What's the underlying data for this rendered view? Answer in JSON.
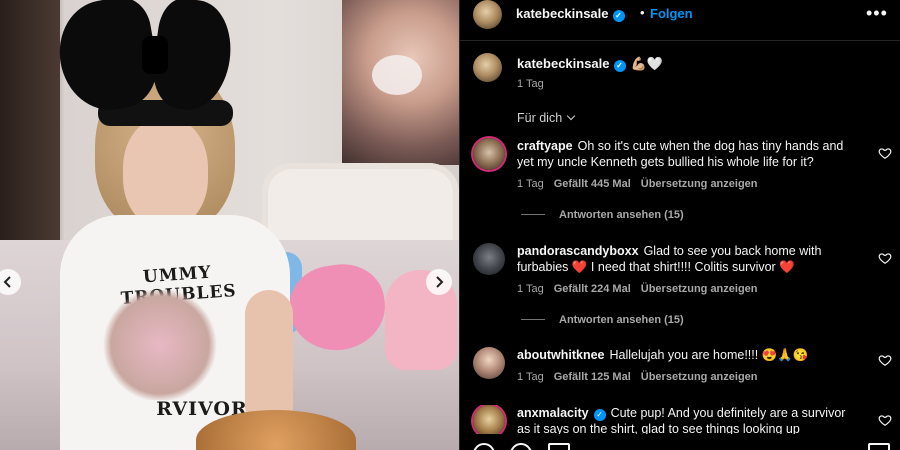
{
  "post": {
    "media": {
      "shirt_text_top": "UMMY TROUBLES",
      "shirt_text_bottom": "RVIVOR",
      "prev_icon": "chevron-left-icon",
      "next_icon": "chevron-right-icon"
    },
    "header": {
      "username": "katebeckinsale",
      "follow_label": "Folgen",
      "separator": "•",
      "more_label": "•••"
    },
    "caption": {
      "username": "katebeckinsale",
      "text": "💪🏼🤍",
      "time": "1 Tag"
    },
    "sort_label": "Für dich",
    "comments": [
      {
        "username": "craftyape",
        "text": "Oh so it's cute when the dog has tiny hands and yet my uncle Kenneth gets bullied his whole life for it?",
        "time": "1 Tag",
        "likes": "Gefällt 445 Mal",
        "translate": "Übersetzung anzeigen",
        "replies": "Antworten ansehen (15)"
      },
      {
        "username": "pandorascandyboxx",
        "text": "Glad to see you back home with furbabies ❤️ I need that shirt!!!! Colitis survivor ❤️",
        "time": "1 Tag",
        "likes": "Gefällt 224 Mal",
        "translate": "Übersetzung anzeigen",
        "replies": "Antworten ansehen (15)"
      },
      {
        "username": "aboutwhitknee",
        "text": "Hallelujah you are home!!!! 😍🙏😘",
        "time": "1 Tag",
        "likes": "Gefällt 125 Mal",
        "translate": "Übersetzung anzeigen"
      },
      {
        "username": "anxmalacity",
        "text": "Cute pup! And you definitely are a survivor as it says on the shirt, glad to see things looking up"
      }
    ],
    "colors": {
      "accent": "#0095f6",
      "muted": "#a8a8a8",
      "background": "#000000",
      "story_ring": "#d62976"
    }
  }
}
